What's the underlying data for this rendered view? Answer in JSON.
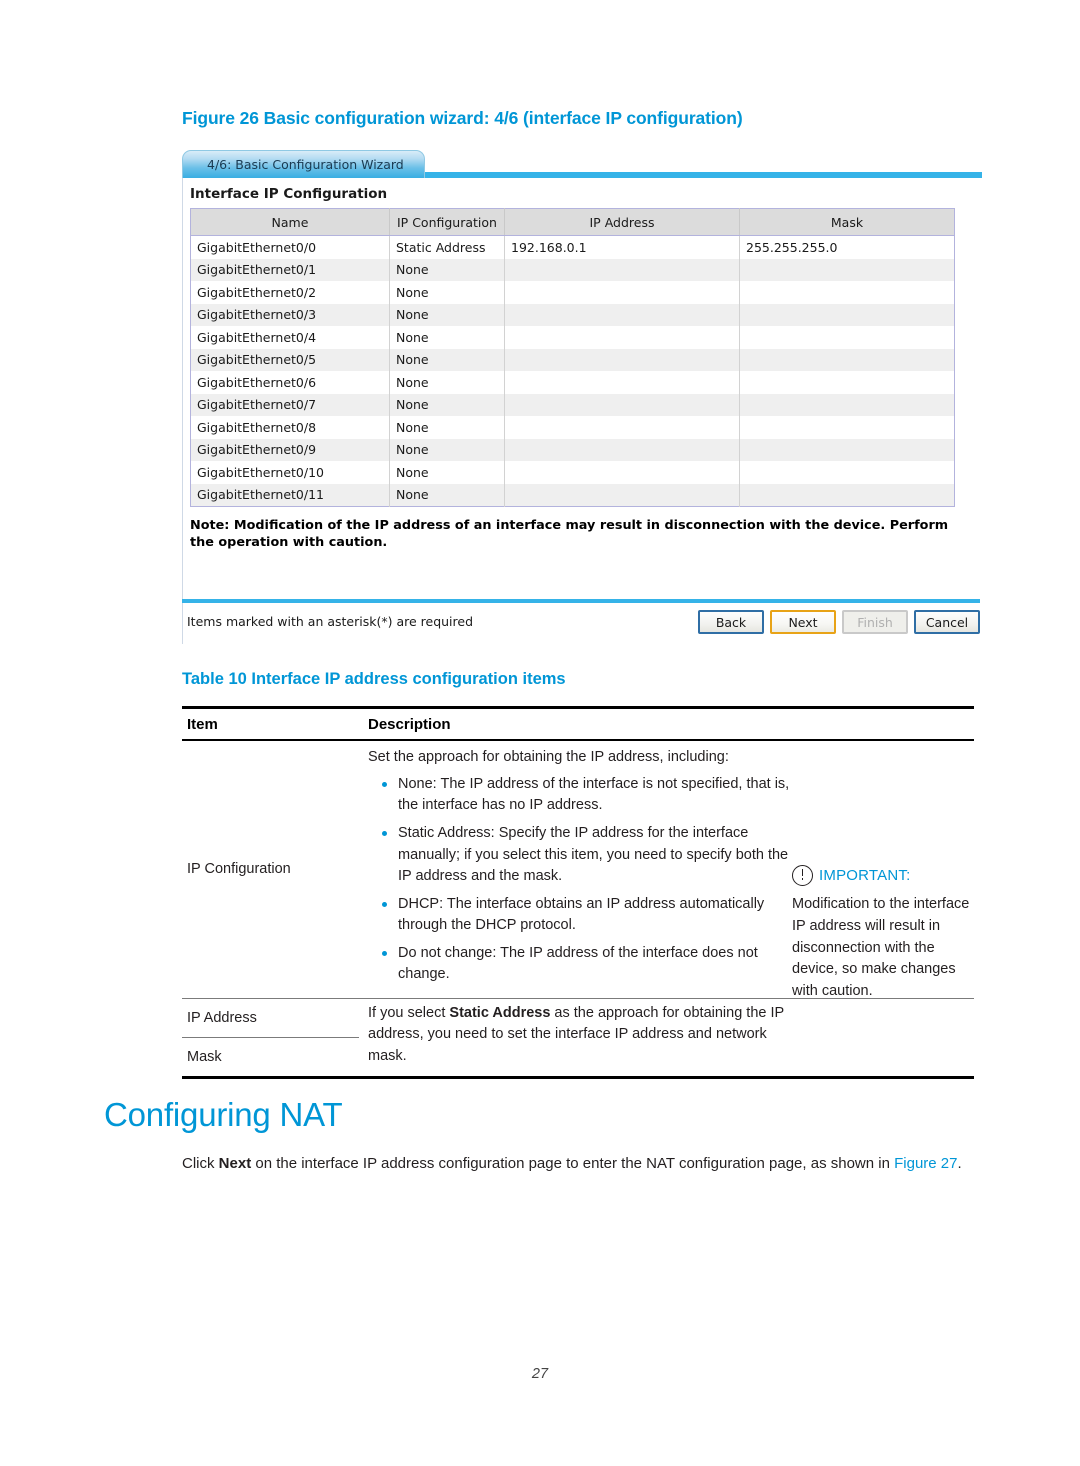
{
  "figure": {
    "caption": "Figure 26 Basic configuration wizard: 4/6 (interface IP configuration)",
    "tab_label": "4/6: Basic Configuration Wizard",
    "section_title": "Interface IP Configuration",
    "note": "Note: Modification of the IP address of an interface may result in disconnection with the device. Perform the operation with caution.",
    "footer_note": "Items marked with an asterisk(*) are required",
    "columns": [
      "Name",
      "IP Configuration",
      "IP Address",
      "Mask"
    ],
    "rows": [
      [
        "GigabitEthernet0/0",
        "Static Address",
        "192.168.0.1",
        "255.255.255.0"
      ],
      [
        "GigabitEthernet0/1",
        "None",
        "",
        ""
      ],
      [
        "GigabitEthernet0/2",
        "None",
        "",
        ""
      ],
      [
        "GigabitEthernet0/3",
        "None",
        "",
        ""
      ],
      [
        "GigabitEthernet0/4",
        "None",
        "",
        ""
      ],
      [
        "GigabitEthernet0/5",
        "None",
        "",
        ""
      ],
      [
        "GigabitEthernet0/6",
        "None",
        "",
        ""
      ],
      [
        "GigabitEthernet0/7",
        "None",
        "",
        ""
      ],
      [
        "GigabitEthernet0/8",
        "None",
        "",
        ""
      ],
      [
        "GigabitEthernet0/9",
        "None",
        "",
        ""
      ],
      [
        "GigabitEthernet0/10",
        "None",
        "",
        ""
      ],
      [
        "GigabitEthernet0/11",
        "None",
        "",
        ""
      ]
    ],
    "buttons": [
      {
        "label": "Back",
        "state": "normal"
      },
      {
        "label": "Next",
        "state": "primary"
      },
      {
        "label": "Finish",
        "state": "disabled"
      },
      {
        "label": "Cancel",
        "state": "normal"
      }
    ]
  },
  "doc_table": {
    "caption": "Table 10 Interface IP address configuration items",
    "headers": {
      "item": "Item",
      "description": "Description"
    },
    "row1": {
      "item": "IP Configuration",
      "lead": "Set the approach for obtaining the IP address, including:",
      "bullets": [
        "None: The IP address of the interface is not specified, that is, the interface has no IP address.",
        "Static Address: Specify the IP address for the interface manually; if you select this item, you need to specify both the IP address and the mask.",
        "DHCP: The interface obtains an IP address automatically through the DHCP protocol.",
        "Do not change: The IP address of the interface does not change."
      ]
    },
    "row2": {
      "item_ip": "IP Address",
      "item_mask": "Mask",
      "description_pre": "If you select ",
      "description_bold": "Static Address",
      "description_post": " as the approach for obtaining the IP address, you need to set the interface IP address and network mask."
    },
    "important": {
      "title": "IMPORTANT:",
      "text": "Modification to the interface IP address will result in disconnection with the device, so make changes with caution."
    }
  },
  "section": {
    "heading": "Configuring NAT",
    "paragraph_pre": "Click ",
    "paragraph_bold": "Next",
    "paragraph_mid": " on the interface IP address configuration page to enter the NAT configuration page, as shown in ",
    "paragraph_link": "Figure 27",
    "paragraph_end": "."
  },
  "page_number": "27",
  "colors": {
    "accent_blue": "#0096d6",
    "wizard_bar": "#35b3e8",
    "primary_button_border": "#e8a317"
  }
}
